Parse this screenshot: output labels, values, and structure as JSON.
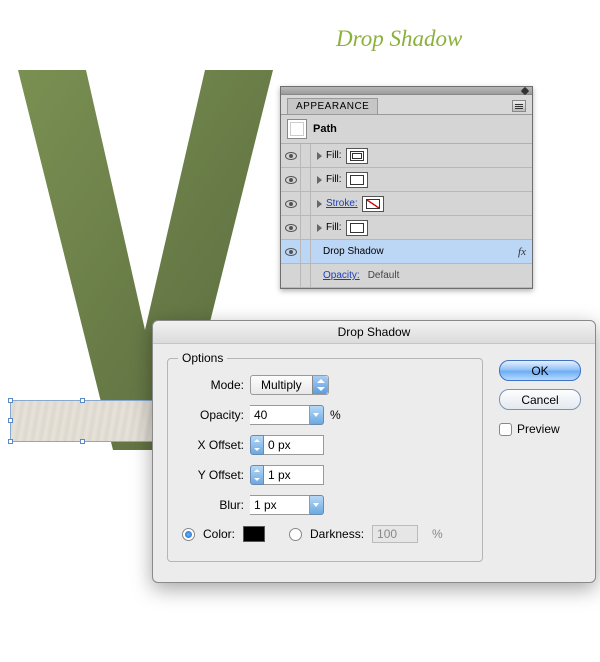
{
  "page_title": "Drop Shadow",
  "appearance_panel": {
    "tab": "APPEARANCE",
    "head": "Path",
    "rows": [
      {
        "label": "Fill:",
        "swatch": "bordered"
      },
      {
        "label": "Fill:",
        "swatch": "plain"
      },
      {
        "label": "Stroke:",
        "swatch": "none",
        "link": true
      },
      {
        "label": "Fill:",
        "swatch": "plain"
      }
    ],
    "effect_row": {
      "label": "Drop Shadow",
      "fx": "fx"
    },
    "opacity_row": {
      "label": "Opacity:",
      "value": "Default"
    }
  },
  "dialog": {
    "title": "Drop Shadow",
    "legend": "Options",
    "mode_label": "Mode:",
    "mode_value": "Multiply",
    "opacity_label": "Opacity:",
    "opacity_value": "40",
    "opacity_unit": "%",
    "xoffset_label": "X Offset:",
    "xoffset_value": "0 px",
    "yoffset_label": "Y Offset:",
    "yoffset_value": "1 px",
    "blur_label": "Blur:",
    "blur_value": "1 px",
    "color_label": "Color:",
    "darkness_label": "Darkness:",
    "darkness_value": "100",
    "darkness_unit": "%",
    "ok": "OK",
    "cancel": "Cancel",
    "preview": "Preview"
  }
}
